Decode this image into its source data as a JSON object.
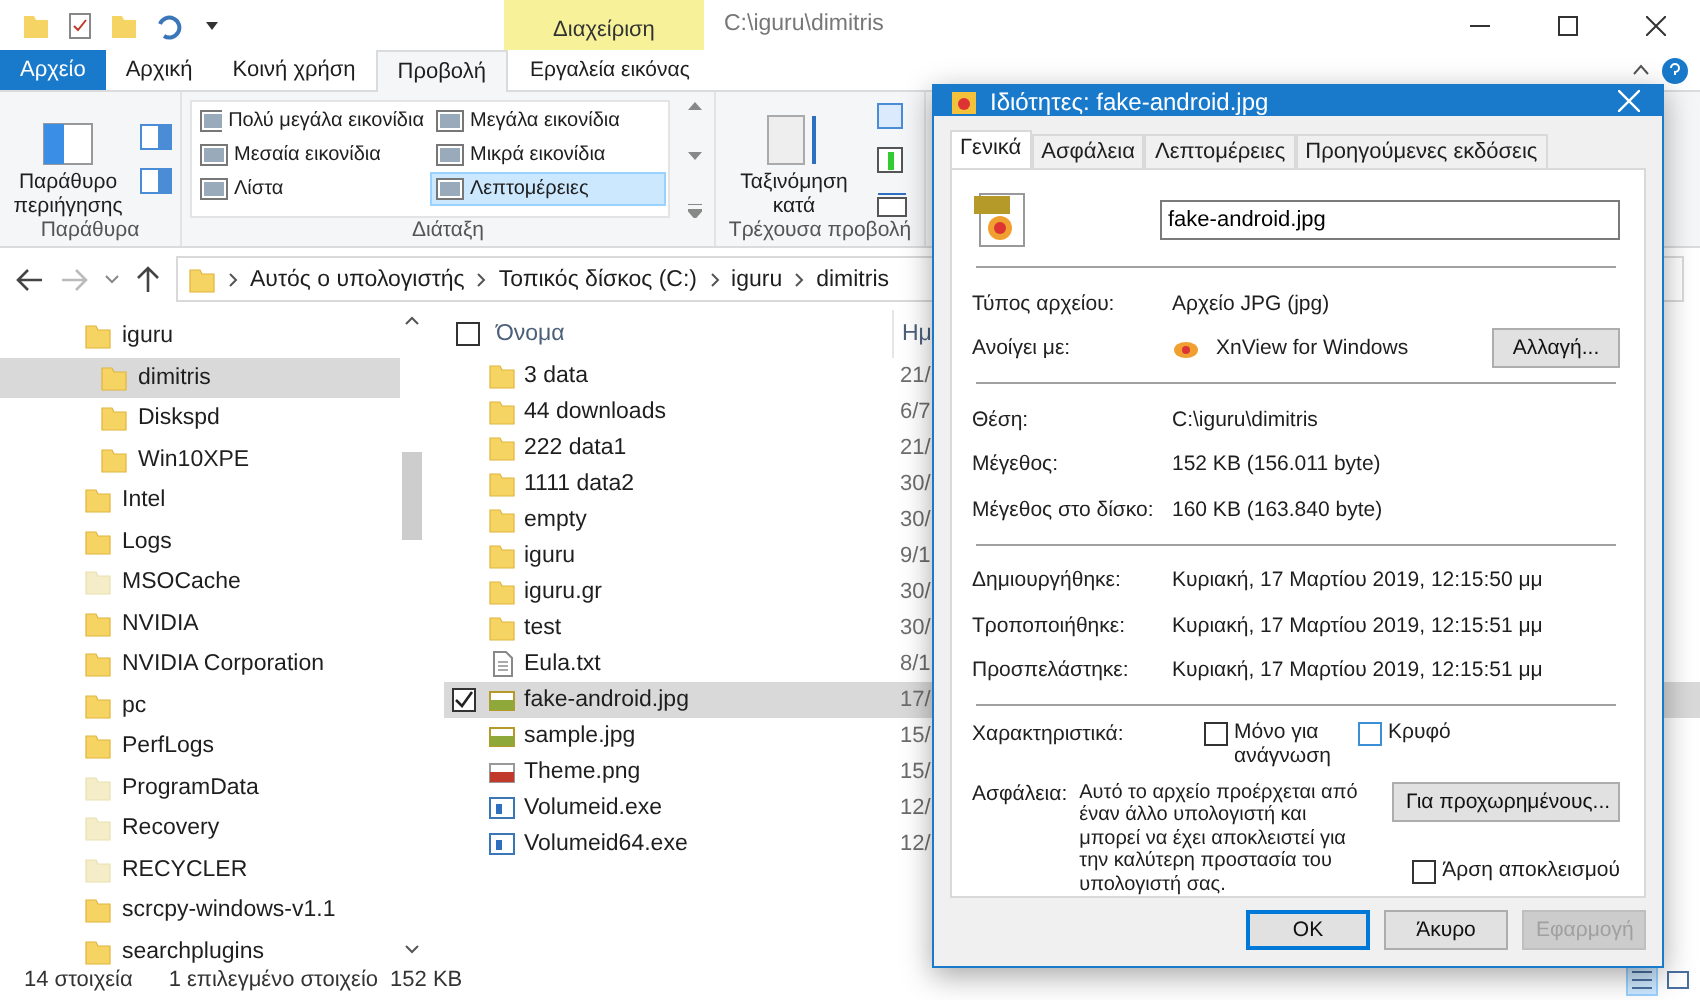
{
  "title_bar": {
    "context_tab": "Διαχείριση",
    "path": "C:\\iguru\\dimitris"
  },
  "ribbon_tabs": [
    {
      "label": "Αρχείο",
      "kind": "file",
      "selected": false
    },
    {
      "label": "Αρχική",
      "kind": "normal",
      "selected": false
    },
    {
      "label": "Κοινή χρήση",
      "kind": "normal",
      "selected": false
    },
    {
      "label": "Προβολή",
      "kind": "normal",
      "selected": true
    },
    {
      "label": "Εργαλεία εικόνας",
      "kind": "context",
      "selected": false
    }
  ],
  "ribbon": {
    "panes_group": {
      "label": "Παράθυρα",
      "nav_pane_button": "Παράθυρο περιήγησης"
    },
    "layout_group": {
      "label": "Διάταξη",
      "options": [
        {
          "label": "Πολύ μεγάλα εικονίδια",
          "selected": false
        },
        {
          "label": "Μεγάλα εικονίδια",
          "selected": false
        },
        {
          "label": "Μεσαία εικονίδια",
          "selected": false
        },
        {
          "label": "Μικρά εικονίδια",
          "selected": false
        },
        {
          "label": "Λίστα",
          "selected": false
        },
        {
          "label": "Λεπτομέρειες",
          "selected": true
        }
      ]
    },
    "current_view_group": {
      "label": "Τρέχουσα προβολή",
      "sort_button": "Ταξινόμηση κατά"
    }
  },
  "address_bar": {
    "segments": [
      "Αυτός ο υπολογιστής",
      "Τοπικός δίσκος (C:)",
      "iguru",
      "dimitris"
    ]
  },
  "navigation_tree": [
    {
      "label": "iguru",
      "selected": false,
      "hidden": false,
      "children": [
        {
          "label": "dimitris",
          "selected": true,
          "hidden": false
        },
        {
          "label": "Diskspd",
          "selected": false,
          "hidden": false
        },
        {
          "label": "Win10XPE",
          "selected": false,
          "hidden": false
        }
      ]
    },
    {
      "label": "Intel",
      "selected": false,
      "hidden": false
    },
    {
      "label": "Logs",
      "selected": false,
      "hidden": false
    },
    {
      "label": "MSOCache",
      "selected": false,
      "hidden": true
    },
    {
      "label": "NVIDIA",
      "selected": false,
      "hidden": false
    },
    {
      "label": "NVIDIA Corporation",
      "selected": false,
      "hidden": false
    },
    {
      "label": "pc",
      "selected": false,
      "hidden": false
    },
    {
      "label": "PerfLogs",
      "selected": false,
      "hidden": false
    },
    {
      "label": "ProgramData",
      "selected": false,
      "hidden": true
    },
    {
      "label": "Recovery",
      "selected": false,
      "hidden": true
    },
    {
      "label": "RECYCLER",
      "selected": false,
      "hidden": true
    },
    {
      "label": "scrcpy-windows-v1.1",
      "selected": false,
      "hidden": false
    },
    {
      "label": "searchplugins",
      "selected": false,
      "hidden": false
    }
  ],
  "file_list": {
    "select_all_checked": false,
    "columns": [
      "Όνομα",
      "Ημ"
    ],
    "rows": [
      {
        "name": "3 data",
        "kind": "folder",
        "date": "21/",
        "selected": false
      },
      {
        "name": "44 downloads",
        "kind": "folder",
        "date": "6/7",
        "selected": false
      },
      {
        "name": "222 data1",
        "kind": "folder",
        "date": "21/",
        "selected": false
      },
      {
        "name": "1111 data2",
        "kind": "folder",
        "date": "30/",
        "selected": false
      },
      {
        "name": "empty",
        "kind": "folder",
        "date": "30/",
        "selected": false
      },
      {
        "name": "iguru",
        "kind": "folder",
        "date": "9/1",
        "selected": false
      },
      {
        "name": "iguru.gr",
        "kind": "folder",
        "date": "30/",
        "selected": false
      },
      {
        "name": "test",
        "kind": "folder",
        "date": "30/",
        "selected": false
      },
      {
        "name": "Eula.txt",
        "kind": "text",
        "date": "8/1",
        "selected": false
      },
      {
        "name": "fake-android.jpg",
        "kind": "jpg",
        "date": "17/",
        "selected": true
      },
      {
        "name": "sample.jpg",
        "kind": "jpg",
        "date": "15/",
        "selected": false
      },
      {
        "name": "Theme.png",
        "kind": "png",
        "date": "15/",
        "selected": false
      },
      {
        "name": "Volumeid.exe",
        "kind": "exe",
        "date": "12/",
        "selected": false
      },
      {
        "name": "Volumeid64.exe",
        "kind": "exe",
        "date": "12/",
        "selected": false
      }
    ]
  },
  "status_bar": {
    "item_count": "14 στοιχεία",
    "selection": "1 επιλεγμένο στοιχείο",
    "size": "152 KB",
    "details_view_selected": true
  },
  "dialog": {
    "title": "Ιδιότητες: fake-android.jpg",
    "tabs": [
      {
        "label": "Γενικά",
        "selected": true
      },
      {
        "label": "Ασφάλεια",
        "selected": false
      },
      {
        "label": "Λεπτομέρειες",
        "selected": false
      },
      {
        "label": "Προηγούμενες εκδόσεις",
        "selected": false
      }
    ],
    "file_name": "fake-android.jpg",
    "sections": [
      [
        {
          "kind": "text",
          "label": "Τύπος αρχείου:",
          "value": "Αρχείο JPG (jpg)"
        },
        {
          "kind": "app",
          "label": "Ανοίγει με:",
          "value": "XnView for Windows",
          "button": "Αλλαγή..."
        }
      ],
      [
        {
          "kind": "text",
          "label": "Θέση:",
          "value": "C:\\iguru\\dimitris"
        },
        {
          "kind": "text",
          "label": "Μέγεθος:",
          "value": "152 KB (156.011 byte)"
        },
        {
          "kind": "text",
          "label": "Μέγεθος στο δίσκο:",
          "value": "160 KB (163.840 byte)"
        }
      ],
      [
        {
          "kind": "text",
          "label": "Δημιουργήθηκε:",
          "value": "Κυριακή, 17 Μαρτίου 2019, 12:15:50 μμ"
        },
        {
          "kind": "text",
          "label": "Τροποποιήθηκε:",
          "value": "Κυριακή, 17 Μαρτίου 2019, 12:15:51 μμ"
        },
        {
          "kind": "text",
          "label": "Προσπελάστηκε:",
          "value": "Κυριακή, 17 Μαρτίου 2019, 12:15:51 μμ"
        }
      ]
    ],
    "attributes": {
      "label": "Χαρακτηριστικά:",
      "options": [
        {
          "label": "Μόνο για ανάγνωση",
          "checked": false
        },
        {
          "label": "Κρυφό",
          "checked": false
        }
      ]
    },
    "security": {
      "label": "Ασφάλεια:",
      "text": "Αυτό το αρχείο προέρχεται από έναν άλλο υπολογιστή και μπορεί να έχει αποκλειστεί για την καλύτερη προστασία του υπολογιστή σας.",
      "button": "Για προχωρημένους...",
      "unblock": {
        "label": "Άρση αποκλεισμού",
        "checked": false
      }
    },
    "buttons": [
      {
        "label": "OK",
        "default": true,
        "disabled": false
      },
      {
        "label": "Άκυρο",
        "default": false,
        "disabled": false
      },
      {
        "label": "Εφαρμογή",
        "default": false,
        "disabled": true
      }
    ]
  }
}
